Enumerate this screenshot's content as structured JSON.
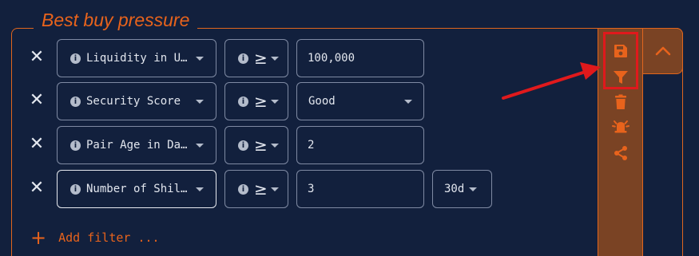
{
  "filter_group": {
    "title": "Best buy pressure",
    "rows": [
      {
        "field": "Liquidity in U…",
        "operator": "≥",
        "value": "100,000",
        "value_is_select": false
      },
      {
        "field": "Security Score",
        "operator": "≥",
        "value": "Good",
        "value_is_select": true
      },
      {
        "field": "Pair Age in Da…",
        "operator": "≥",
        "value": "2",
        "value_is_select": false
      },
      {
        "field": "Number of Shil…",
        "operator": "≥",
        "value": "3",
        "value_is_select": false,
        "period": "30d"
      }
    ],
    "add_filter_label": "Add filter ..."
  },
  "side_panel": {
    "icons": [
      "save-icon",
      "filter-icon",
      "trash-icon",
      "alarm-icon",
      "share-icon"
    ],
    "collapse_icon": "chevron-up-icon",
    "highlighted": [
      "save-icon",
      "filter-icon"
    ]
  },
  "colors": {
    "background": "#12203d",
    "accent": "#e8631c",
    "panel": "#7a4324",
    "annotation": "#e0191c"
  }
}
